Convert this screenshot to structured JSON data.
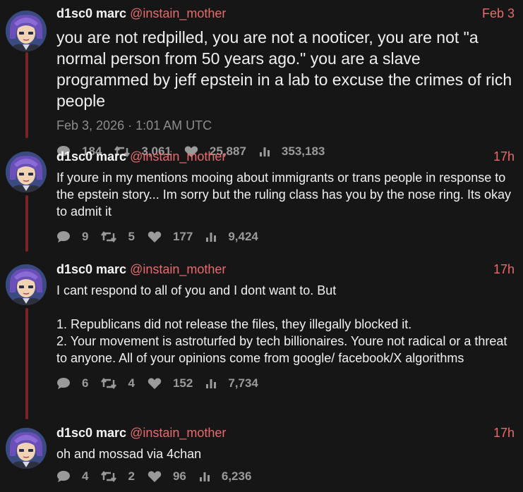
{
  "author": {
    "name": "d1sc0 marc",
    "handle": "@instain_mother"
  },
  "tweets": [
    {
      "time": "Feb 3",
      "text": "you are not redpilled, you are not a nooticer, you are not \"a normal person from 50 years ago.\" you are a slave programmed by jeff epstein in a lab to excuse the crimes of rich people",
      "published": "Feb 3, 2026 · 1:01 AM UTC",
      "replies": "184",
      "retweets": "3,061",
      "likes": "25,887",
      "views": "353,183"
    },
    {
      "time": "17h",
      "text": "If youre in my mentions mooing about immigrants or trans people in response to the epstein story... Im sorry but the ruling class has you by the nose ring. Its okay to admit it",
      "replies": "9",
      "retweets": "5",
      "likes": "177",
      "views": "9,424"
    },
    {
      "time": "17h",
      "text": "I cant respond to all of you and I dont want to. But\n\n1. Republicans did not release the files, they illegally blocked it.\n2. Your movement is astroturfed by tech billionaires. Youre not radical or a threat to anyone. All of your opinions come from google/ facebook/X algorithms",
      "replies": "6",
      "retweets": "4",
      "likes": "152",
      "views": "7,734"
    },
    {
      "time": "17h",
      "text": "oh and mossad via 4chan",
      "replies": "4",
      "retweets": "2",
      "likes": "96",
      "views": "6,236"
    }
  ],
  "colors": {
    "background": "#161616",
    "accent": "#e86a6a",
    "thread_line": "#7a2323",
    "muted": "#9a9a9a"
  },
  "icons": {
    "replies": "comment-icon",
    "retweets": "retweet-icon",
    "likes": "heart-icon",
    "views": "views-icon"
  }
}
